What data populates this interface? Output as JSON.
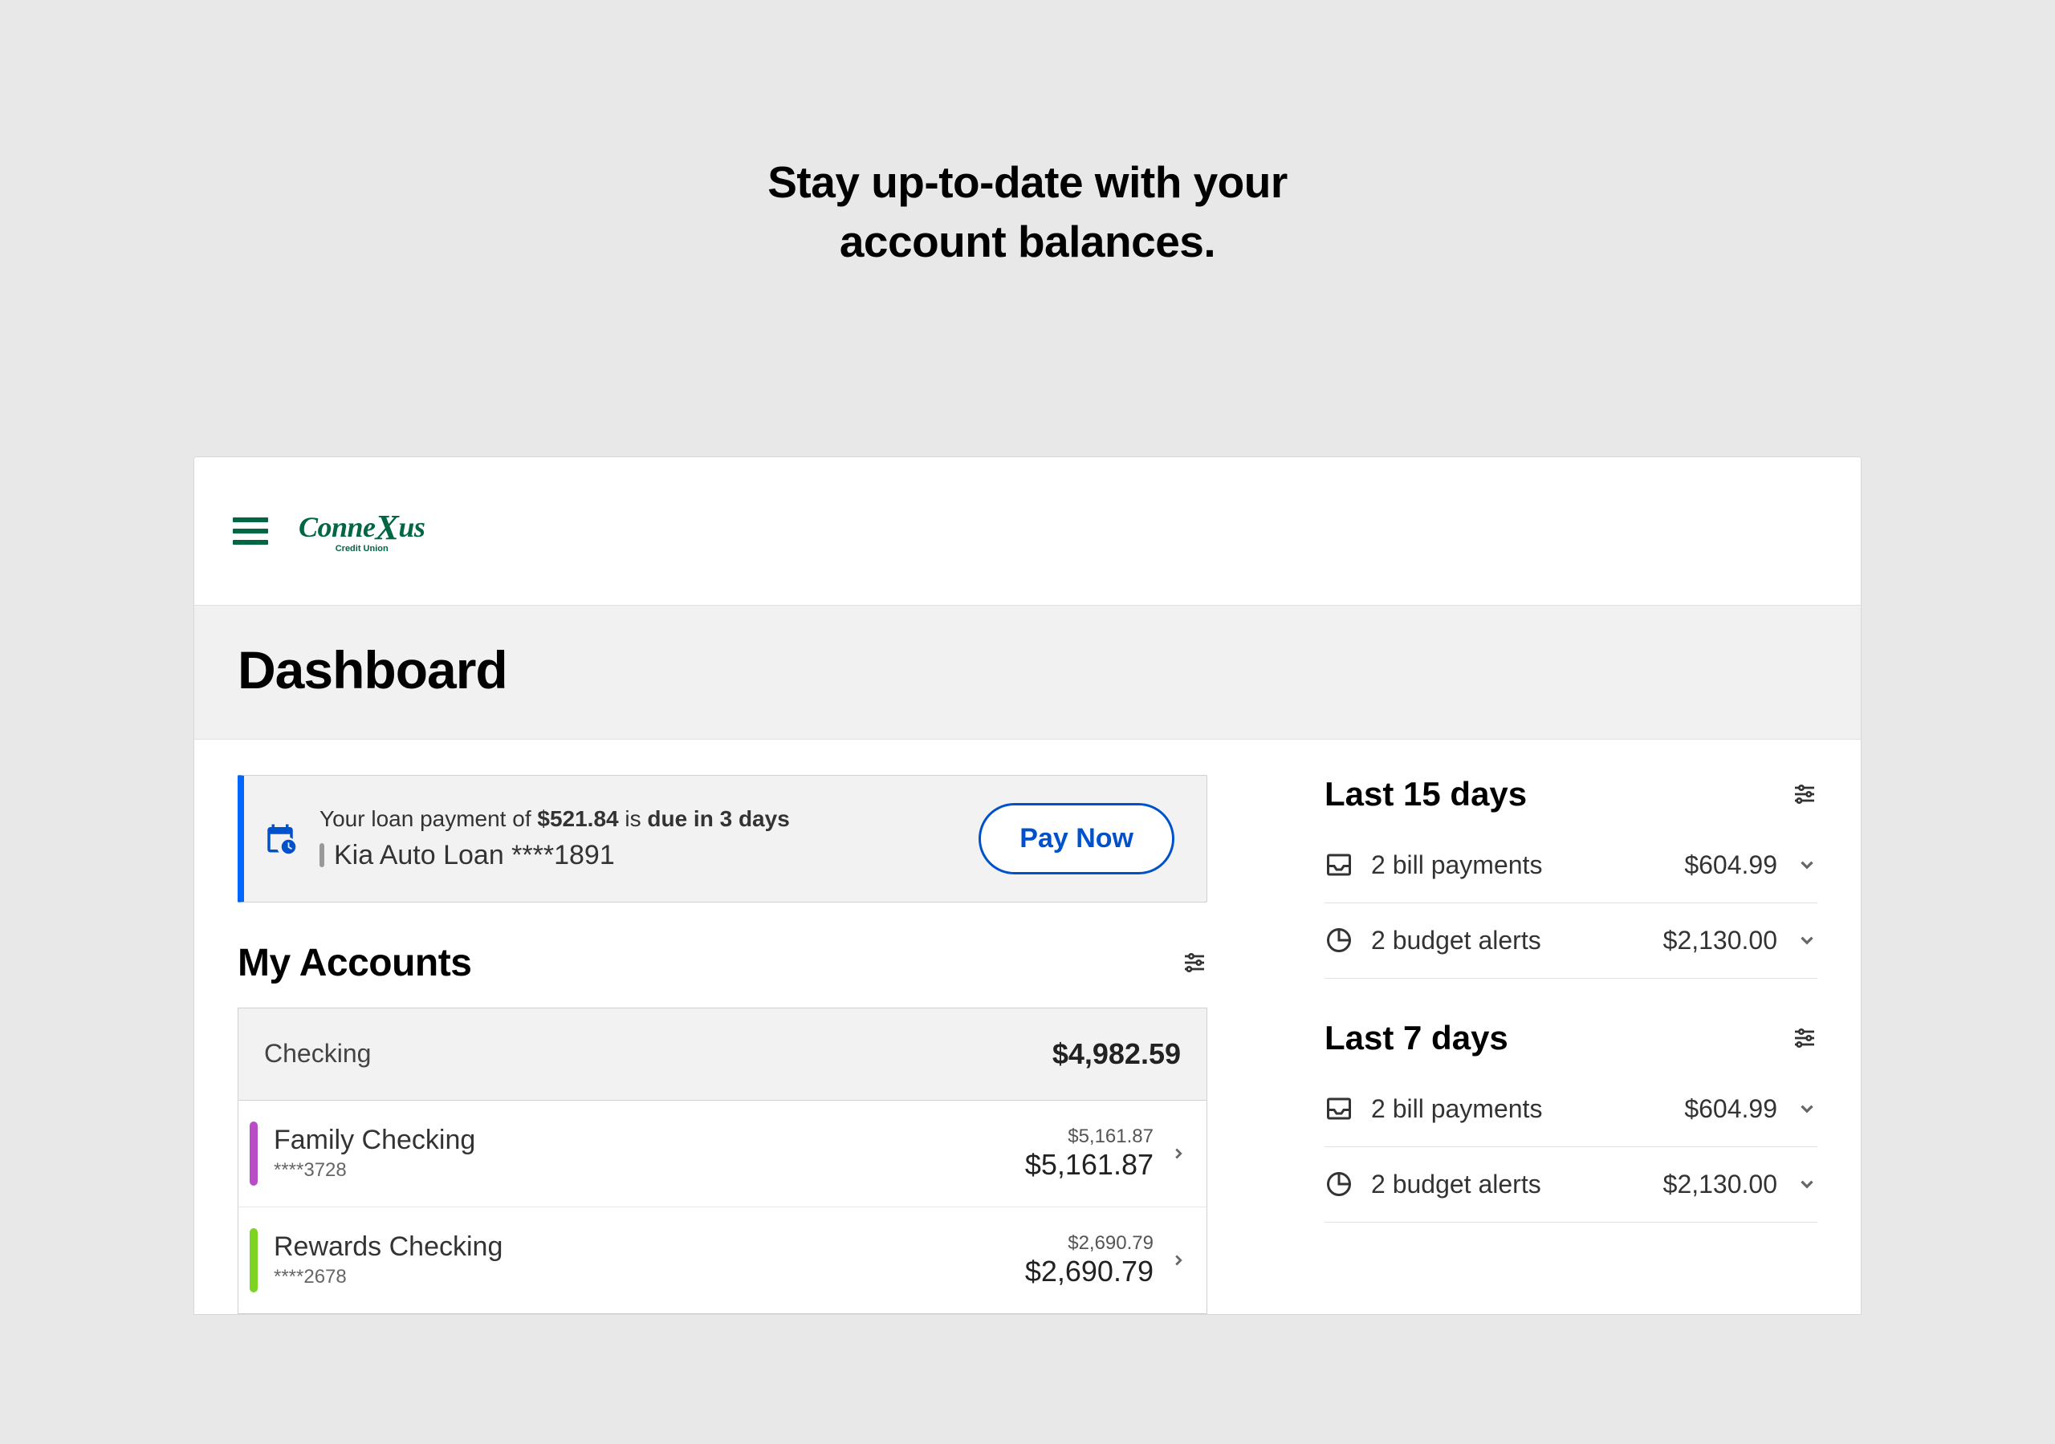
{
  "hero": {
    "line1": "Stay up-to-date with your",
    "line2": "account balances."
  },
  "logo": {
    "brand": "Connexus",
    "subtitle": "Credit Union"
  },
  "page_title": "Dashboard",
  "alert": {
    "prefix": "Your loan payment of ",
    "amount": "$521.84",
    "mid": " is ",
    "due": "due in 3 days",
    "account_label": "Kia Auto Loan ****1891",
    "button": "Pay Now"
  },
  "my_accounts": {
    "title": "My Accounts",
    "group": {
      "name": "Checking",
      "total": "$4,982.59"
    },
    "rows": [
      {
        "name": "Family Checking",
        "mask": "****3728",
        "balance_small": "$5,161.87",
        "balance_large": "$5,161.87",
        "marker": "marker-purple"
      },
      {
        "name": "Rewards Checking",
        "mask": "****2678",
        "balance_small": "$2,690.79",
        "balance_large": "$2,690.79",
        "marker": "marker-green"
      }
    ]
  },
  "summaries": [
    {
      "title": "Last 15 days",
      "rows": [
        {
          "icon": "bill",
          "label": "2 bill payments",
          "amount": "$604.99"
        },
        {
          "icon": "budget",
          "label": "2 budget alerts",
          "amount": "$2,130.00"
        }
      ]
    },
    {
      "title": "Last 7 days",
      "rows": [
        {
          "icon": "bill",
          "label": "2 bill payments",
          "amount": "$604.99"
        },
        {
          "icon": "budget",
          "label": "2 budget alerts",
          "amount": "$2,130.00"
        }
      ]
    }
  ]
}
